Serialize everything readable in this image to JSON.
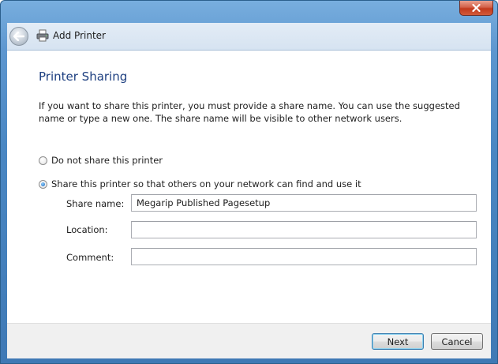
{
  "window": {
    "title": "Add Printer"
  },
  "page": {
    "heading": "Printer Sharing",
    "description": "If you want to share this printer, you must provide a share name. You can use the suggested name or type a new one. The share name will be visible to other network users."
  },
  "options": [
    {
      "label": "Do not share this printer",
      "selected": false
    },
    {
      "label": "Share this printer so that others on your network can find and use it",
      "selected": true
    }
  ],
  "fields": [
    {
      "label": "Share name:",
      "value": "Megarip Published Pagesetup"
    },
    {
      "label": "Location:",
      "value": ""
    },
    {
      "label": "Comment:",
      "value": ""
    }
  ],
  "buttons": {
    "next": "Next",
    "cancel": "Cancel"
  },
  "icons": {
    "close": "close-icon",
    "back": "back-arrow-icon",
    "printer": "printer-icon"
  }
}
